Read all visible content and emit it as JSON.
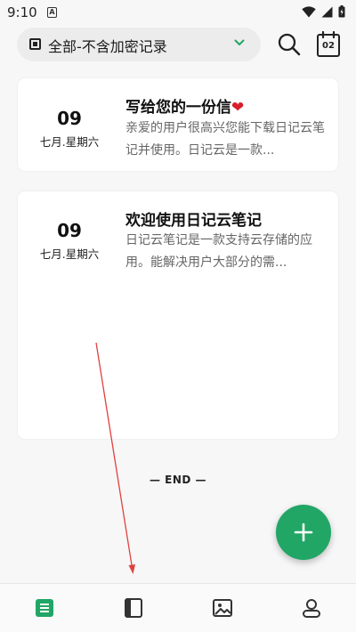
{
  "status_bar": {
    "time": "9:10",
    "app_icon_letter": "A"
  },
  "top_bar": {
    "filter_label": "全部-不含加密记录",
    "calendar_day": "02"
  },
  "notes": [
    {
      "day": "09",
      "sub": "七月.星期六",
      "title": "写给您的一份信",
      "title_emoji": "❤",
      "excerpt": "亲爱的用户很高兴您能下载日记云笔记并使用。日记云是一款..."
    },
    {
      "day": "09",
      "sub": "七月.星期六",
      "title": "欢迎使用日记云笔记",
      "excerpt": "日记云笔记是一款支持云存储的应用。能解决用户大部分的需..."
    }
  ],
  "end_label": "— END —",
  "colors": {
    "accent": "#21a665",
    "heart": "#d91e2b",
    "arrow": "#e0413f"
  },
  "bottom_nav": [
    {
      "icon": "notes-list-icon",
      "active": true
    },
    {
      "icon": "notebook-icon",
      "active": false
    },
    {
      "icon": "image-icon",
      "active": false
    },
    {
      "icon": "profile-icon",
      "active": false
    }
  ]
}
